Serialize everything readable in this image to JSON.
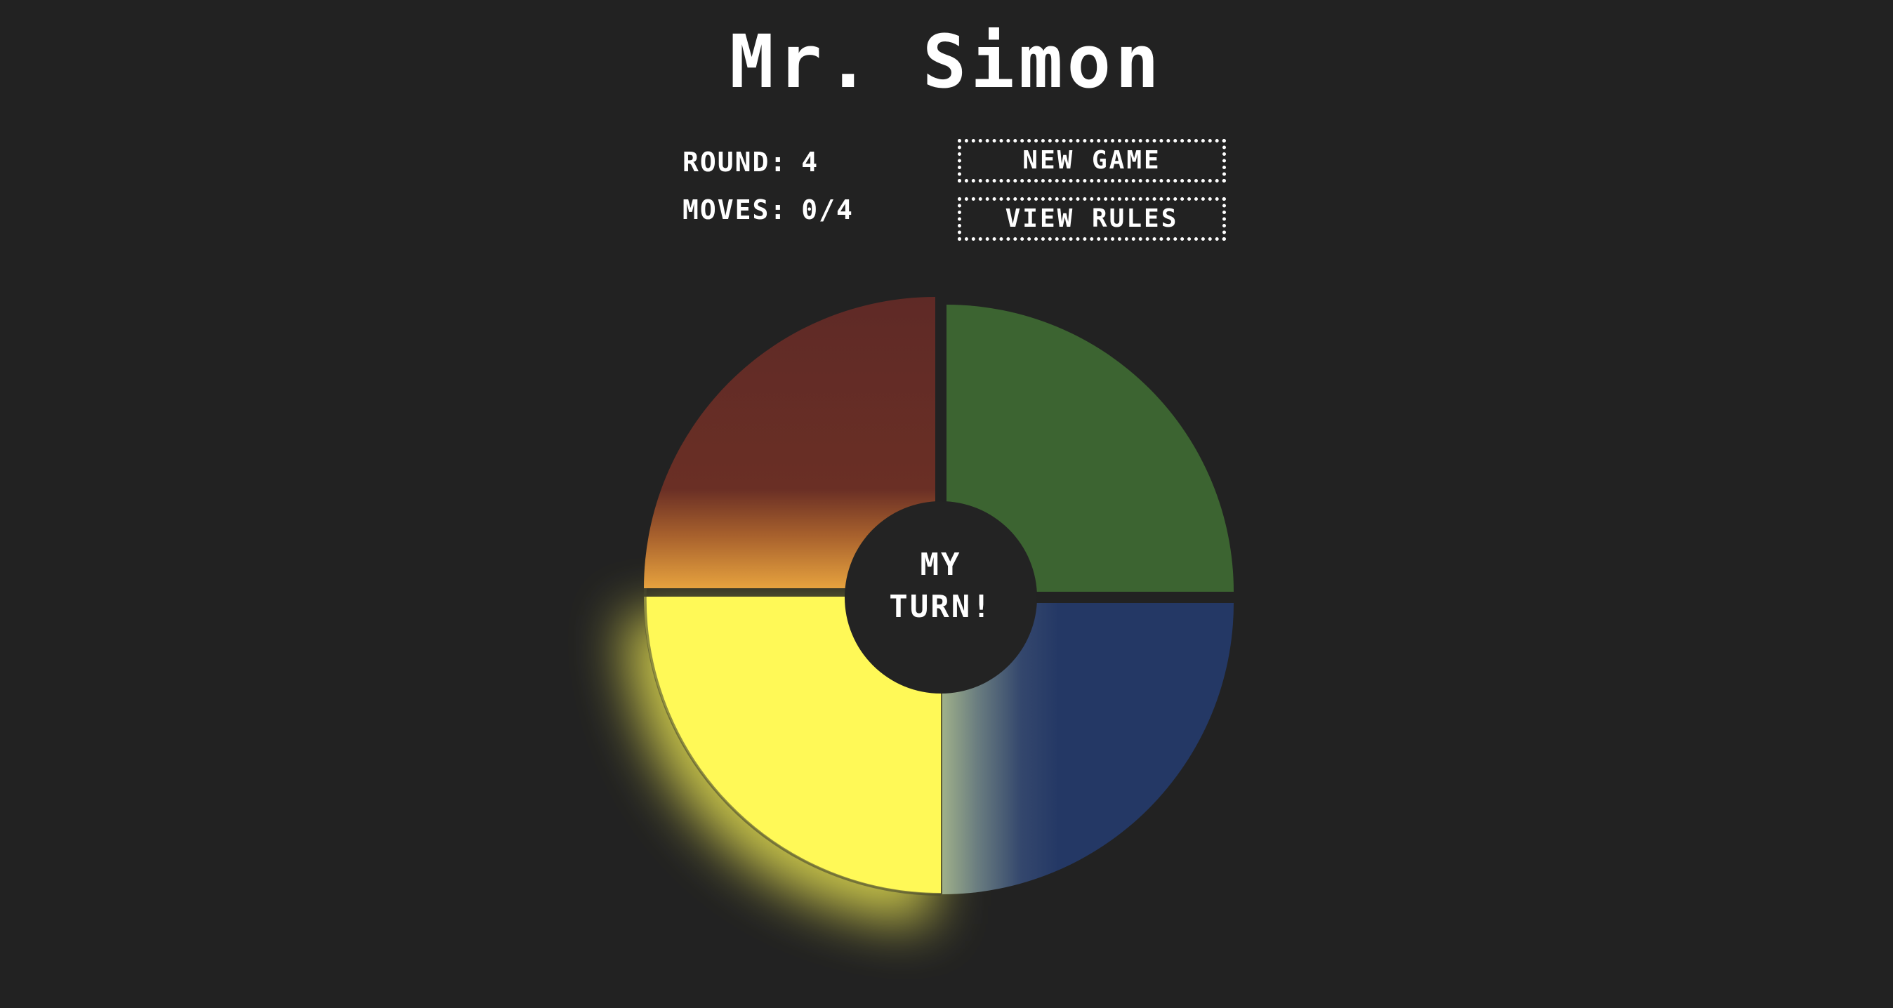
{
  "app": {
    "title": "Mr. Simon"
  },
  "stats": {
    "round_label": "ROUND:",
    "round_value": "4",
    "moves_label": "MOVES:",
    "moves_value": "0/4"
  },
  "controls": {
    "new_game_label": "NEW GAME",
    "view_rules_label": "VIEW RULES"
  },
  "board": {
    "center_line1": "MY",
    "center_line2": "TURN!",
    "active_pad": "yellow",
    "pads": [
      {
        "name": "red",
        "color": "#5f2a26",
        "lit": false
      },
      {
        "name": "green",
        "color": "#3c6431",
        "lit": false
      },
      {
        "name": "yellow",
        "color": "#fff957",
        "lit": true
      },
      {
        "name": "blue",
        "color": "#243865",
        "lit": false
      }
    ],
    "background_color": "#222222",
    "hub_color": "#232323"
  }
}
